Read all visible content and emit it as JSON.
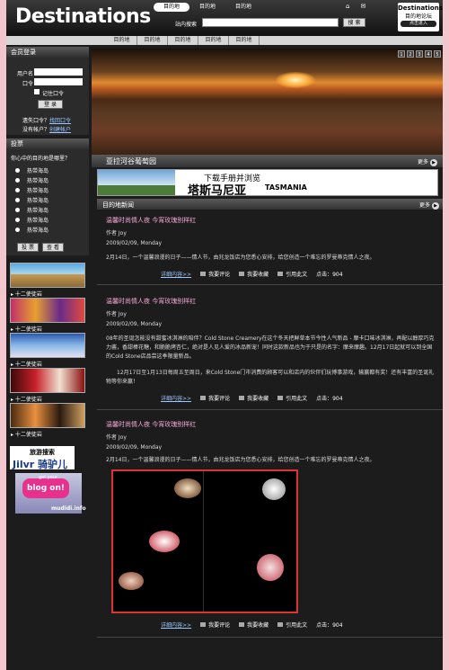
{
  "header": {
    "logo": "Destinations",
    "nav": [
      "目的地",
      "目的地",
      "目的地"
    ],
    "icons": [
      "home-icon",
      "mail-icon"
    ],
    "search_label": "站内搜索",
    "search_button": "搜 索",
    "badge_title": "Destinations",
    "badge_sub": "目的地论坛",
    "badge_link": "点击进入"
  },
  "subnav": [
    "目的地",
    "目的地",
    "目的地",
    "目的地",
    "目的地"
  ],
  "login": {
    "title": "会员登录",
    "username_label": "用户名",
    "password_label": "口令",
    "remember_label": "记住口令",
    "login_button": "登 录",
    "forgot_text": "遗失口令？",
    "forgot_link": "找回口令",
    "noacct_text": "没有帐户？",
    "register_link": "创建帐户"
  },
  "poll": {
    "title": "投票",
    "question": "你心中的目的地是哪里？",
    "options": [
      "热带海岛",
      "热带海岛",
      "热带海岛",
      "热带海岛",
      "热带海岛",
      "热带海岛",
      "热带海岛"
    ],
    "vote_button": "投 票",
    "view_button": "查 看"
  },
  "gallery": {
    "captions": [
      "十二使徒岩",
      "十二使徒岩",
      "十二使徒岩",
      "十二使徒岩",
      "十二使徒岩"
    ]
  },
  "ads": {
    "ad1_top": "旅游搜索",
    "ad1_brand": "Jilvr 骑驴儿",
    "ad2_text": "blog on!",
    "ad2_small": "get your",
    "ad2_site": "mudidi.info"
  },
  "hero": {
    "caption": "亚拉河谷葡萄园",
    "more": "更多",
    "pages": [
      "1",
      "2",
      "3",
      "4",
      "5"
    ]
  },
  "banner": {
    "line1": "下载手册并浏览",
    "line2": "塔斯马尼亚",
    "brand": "TASMANIA"
  },
  "news": {
    "title": "目的地新闻",
    "more": "更多",
    "articles": [
      {
        "title": "温馨时尚情人夜 今宵玫瑰别样红",
        "author": "作者 Joy",
        "date": "2009/02/09, Monday",
        "body": "2月14日，一个温馨浪漫的日子——情人节，由兆龙饭店为您悉心安排，给您创造一个难忘的罗曼蒂克情人之夜。"
      },
      {
        "title": "温馨时尚情人夜 今宵玫瑰别样红",
        "author": "作者 Joy",
        "date": "2009/02/09, Monday",
        "body": "08年的圣诞怎能没有甜蜜冰淇淋的陪伴？Cold Stone Creamery在这个冬天把鲜草本节今性人气新品 - 摩卡口味冰淇淋，再配以醇厚巧克力酱，香甜棒花糖，和脆脆烤杏仁，绝对是人见人爱的冰品新宠！同时这款新品也为于只是的名字：摩来摩趣。12月17日起就可以到全国的Cold Stone店品尝这季限量新品。",
        "body2": "12月17日至1月13日每周五至周日，来Cold Stone门市消费的顾客可以和店内的伙伴们玩博事游戏，输赢都有奖！还有丰富的圣诞礼物等你来赢！"
      },
      {
        "title": "温馨时尚情人夜 今宵玫瑰别样红",
        "author": "作者 Joy",
        "date": "2009/02/09, Monday",
        "body": "2月14日，一个温馨浪漫的日子——情人节，由兆龙饭店为您悉心安排，给您创造一个难忘的罗曼蒂克情人之夜。"
      }
    ],
    "actions": {
      "detail": "详细内容>>",
      "comment": "我要评论",
      "favorite": "我要收藏",
      "quote": "引用此文",
      "clicks": "点击：904"
    }
  }
}
